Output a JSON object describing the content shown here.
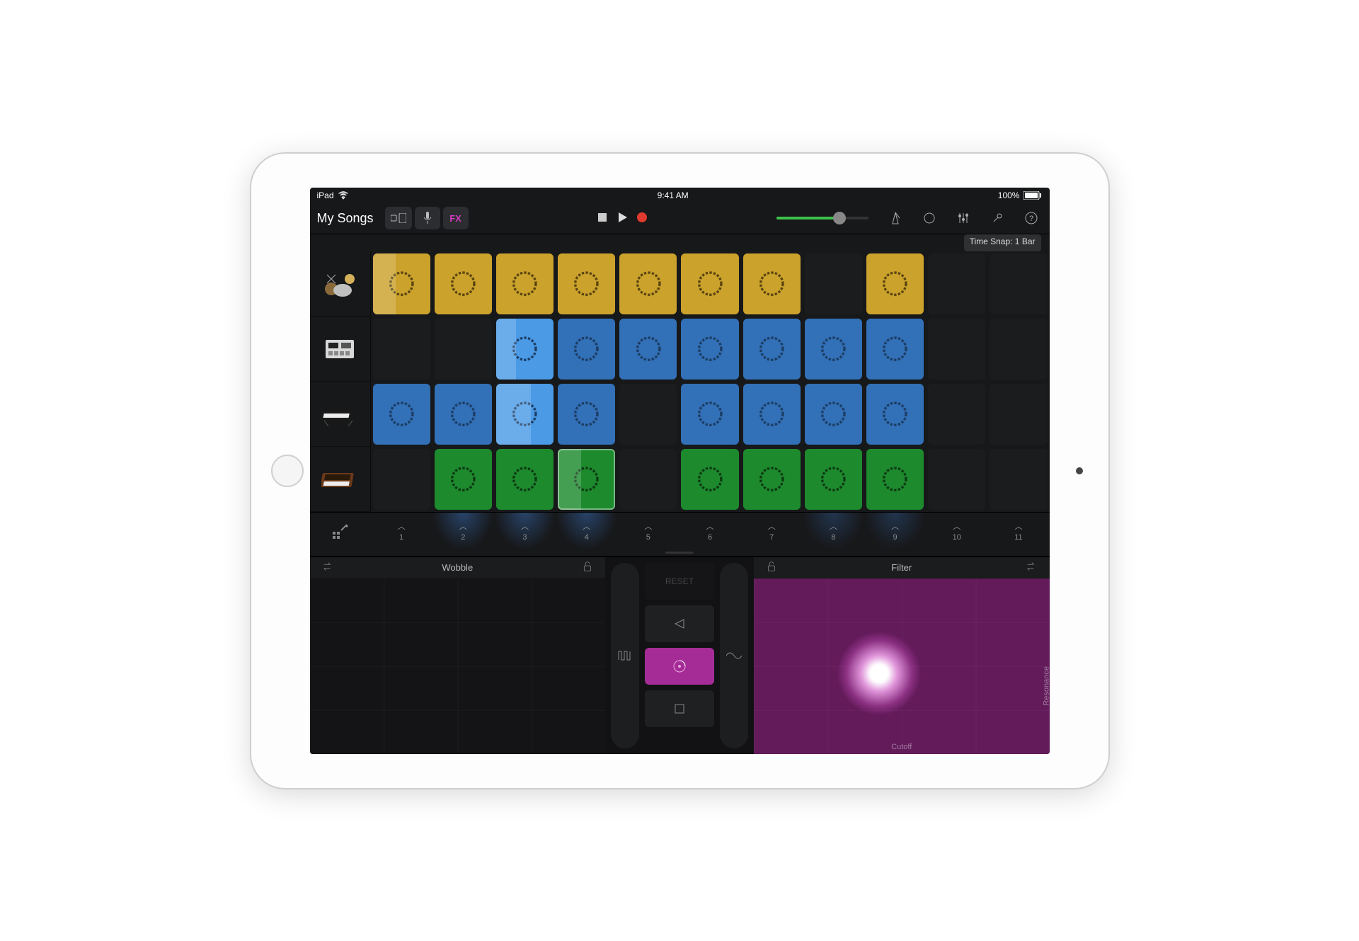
{
  "status": {
    "device": "iPad",
    "time": "9:41 AM",
    "battery_text": "100%"
  },
  "toolbar": {
    "title": "My Songs",
    "fx_label": "FX",
    "timesnap": "Time Snap: 1 Bar",
    "volume_pct": 70
  },
  "tracks": [
    {
      "name": "drums"
    },
    {
      "name": "drum-machine"
    },
    {
      "name": "keyboard"
    },
    {
      "name": "synth"
    }
  ],
  "grid": {
    "rows": [
      {
        "color": "yellow",
        "cells": [
          "p40",
          "f",
          "f",
          "f",
          "f",
          "f",
          "f",
          "",
          "f",
          "",
          ""
        ]
      },
      {
        "color": "blue",
        "cells": [
          "",
          "",
          "L",
          "f",
          "f",
          "f",
          "f",
          "f",
          "f",
          "",
          ""
        ]
      },
      {
        "color": "blue",
        "cells": [
          "f",
          "f",
          "L60",
          "f",
          "",
          "f",
          "f",
          "f",
          "f",
          "",
          ""
        ]
      },
      {
        "color": "green",
        "cells": [
          "",
          "f",
          "f",
          "A",
          "",
          "f",
          "f",
          "f",
          "f",
          "",
          ""
        ]
      }
    ]
  },
  "triggers": {
    "labels": [
      "1",
      "2",
      "3",
      "4",
      "5",
      "6",
      "7",
      "8",
      "9",
      "10",
      "11"
    ],
    "glow": [
      1,
      2,
      3,
      7,
      8
    ]
  },
  "fx": {
    "left": {
      "title": "Wobble"
    },
    "right": {
      "title": "Filter",
      "x_axis": "Cutoff",
      "y_axis": "Resonance"
    },
    "reset_label": "RESET"
  }
}
